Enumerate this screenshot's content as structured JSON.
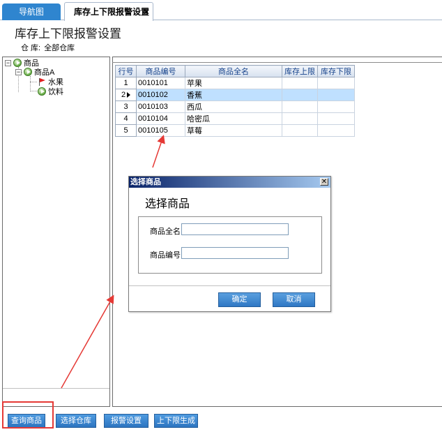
{
  "tabs": {
    "nav_label": "导航图",
    "active_label": "库存上下限报警设置",
    "close_glyph": "✕"
  },
  "page": {
    "title": "库存上下限报警设置",
    "warehouse_label": "仓      库:",
    "warehouse_value": "全部仓库"
  },
  "tree": {
    "root": "商品",
    "child": "商品A",
    "leaf1": "水果",
    "leaf2": "饮料",
    "expand_glyph": "−"
  },
  "grid": {
    "headers": [
      "行号",
      "商品编号",
      "商品全名",
      "库存上限",
      "库存下限"
    ],
    "rows": [
      {
        "num": "1",
        "code": "0010101",
        "name": "苹果",
        "upper": "",
        "lower": ""
      },
      {
        "num": "2",
        "code": "0010102",
        "name": "香蕉",
        "upper": "",
        "lower": ""
      },
      {
        "num": "3",
        "code": "0010103",
        "name": "西瓜",
        "upper": "",
        "lower": ""
      },
      {
        "num": "4",
        "code": "0010104",
        "name": "哈密瓜",
        "upper": "",
        "lower": ""
      },
      {
        "num": "5",
        "code": "0010105",
        "name": "草莓",
        "upper": "",
        "lower": ""
      }
    ],
    "selected_row": 1
  },
  "dialog": {
    "title": "选择商品",
    "close_glyph": "✕",
    "heading": "选择商品",
    "name_label": "商品全名",
    "name_value": "",
    "code_label": "商品编号",
    "code_value": "",
    "ok_label": "确定",
    "cancel_label": "取消"
  },
  "toolbar": {
    "query_label": "查询商品",
    "warehouse_label": "选择仓库",
    "alarm_label": "报警设置",
    "generate_label": "上下限生成"
  },
  "colors": {
    "accent": "#2f85cf",
    "annotation": "#e53935",
    "selected_row": "#bfe0ff"
  }
}
